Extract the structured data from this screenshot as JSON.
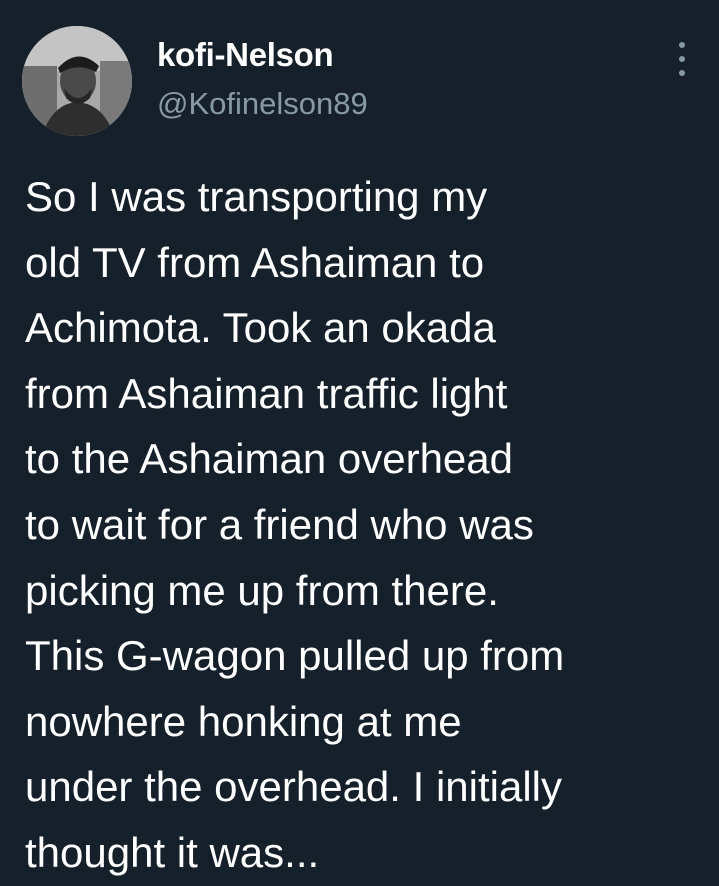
{
  "tweet": {
    "author": {
      "display_name": "kofi-Nelson",
      "handle": "@Kofinelson89",
      "avatar_icon": "profile-photo"
    },
    "menu_icon": "more-vertical-icon",
    "text_lines": [
      "So I was transporting my",
      "old TV from Ashaiman to",
      "Achimota. Took an okada",
      "from Ashaiman traffic light",
      "to the Ashaiman overhead",
      "to wait for a friend who was",
      "picking me up from there.",
      "This G-wagon pulled up from",
      "nowhere honking at me",
      "under the overhead. I initially",
      "thought it was..."
    ]
  },
  "colors": {
    "background": "#15202b",
    "text_primary": "#ffffff",
    "text_secondary": "#8899a6"
  }
}
